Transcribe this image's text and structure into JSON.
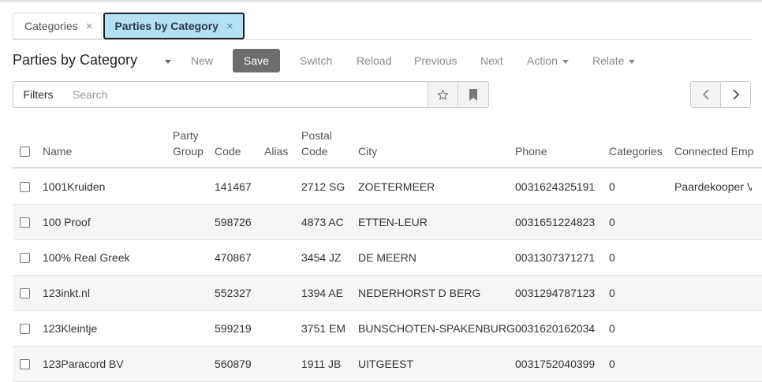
{
  "tabs": [
    {
      "label": "Categories",
      "close": "×"
    },
    {
      "label": "Parties by Category",
      "close": "×"
    }
  ],
  "toolbar": {
    "title": "Parties by Category",
    "new": "New",
    "save": "Save",
    "switch": "Switch",
    "reload": "Reload",
    "previous": "Previous",
    "next": "Next",
    "action": "Action",
    "relate": "Relate"
  },
  "search": {
    "filters": "Filters",
    "placeholder": "Search"
  },
  "table": {
    "columns": {
      "name": "Name",
      "party_group": "Party\nGroup",
      "code": "Code",
      "alias": "Alias",
      "postal_code": "Postal\nCode",
      "city": "City",
      "phone": "Phone",
      "categories": "Categories",
      "connected": "Connected Emp"
    },
    "rows": [
      {
        "name": "1001Kruiden",
        "party_group": "",
        "code": "141467",
        "alias": "",
        "postal_code": "2712 SG",
        "city": "ZOETERMEER",
        "phone": "0031624325191",
        "categories": "0",
        "connected": "Paardekooper V"
      },
      {
        "name": "100 Proof",
        "party_group": "",
        "code": "598726",
        "alias": "",
        "postal_code": "4873 AC",
        "city": "ETTEN-LEUR",
        "phone": "0031651224823",
        "categories": "0",
        "connected": ""
      },
      {
        "name": "100% Real Greek",
        "party_group": "",
        "code": "470867",
        "alias": "",
        "postal_code": "3454 JZ",
        "city": "DE MEERN",
        "phone": "0031307371271",
        "categories": "0",
        "connected": ""
      },
      {
        "name": "123inkt.nl",
        "party_group": "",
        "code": "552327",
        "alias": "",
        "postal_code": "1394 AE",
        "city": "NEDERHORST D BERG",
        "phone": "0031294787123",
        "categories": "0",
        "connected": ""
      },
      {
        "name": "123Kleintje",
        "party_group": "",
        "code": "599219",
        "alias": "",
        "postal_code": "3751 EM",
        "city": "BUNSCHOTEN-SPAKENBURG",
        "phone": "0031620162034",
        "categories": "0",
        "connected": ""
      },
      {
        "name": "123Paracord BV",
        "party_group": "",
        "code": "560879",
        "alias": "",
        "postal_code": "1911 JB",
        "city": "UITGEEST",
        "phone": "0031752040399",
        "categories": "0",
        "connected": ""
      }
    ]
  }
}
